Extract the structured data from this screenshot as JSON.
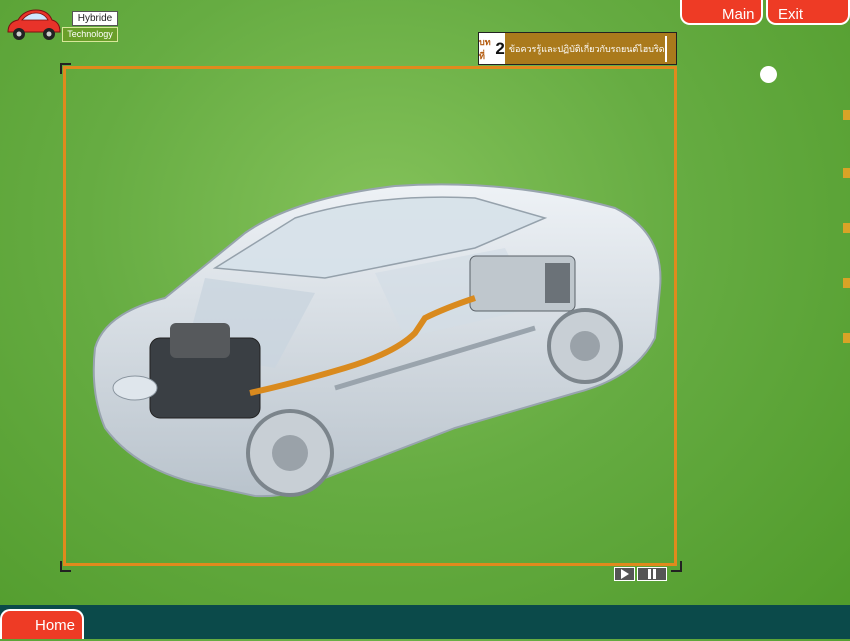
{
  "logo": {
    "line1": "Hybride",
    "line2": "Technology"
  },
  "nav": {
    "main_label": "Main",
    "exit_label": "Exit",
    "home_label": "Home"
  },
  "chapter": {
    "prefix": "บทที่",
    "number": "2",
    "title": "ข้อควรรู้และปฏิบัติเกี่ยวกับรถยนต์ไฮบริด"
  },
  "media": {
    "play_icon": "play-icon",
    "pause_icon": "pause-icon"
  },
  "colors": {
    "background": "#66ac42",
    "frame": "#e08a1d",
    "button": "#ee3b25",
    "bottom_bar": "#0b4a4a",
    "chapter_bg": "#aa7a1c"
  }
}
